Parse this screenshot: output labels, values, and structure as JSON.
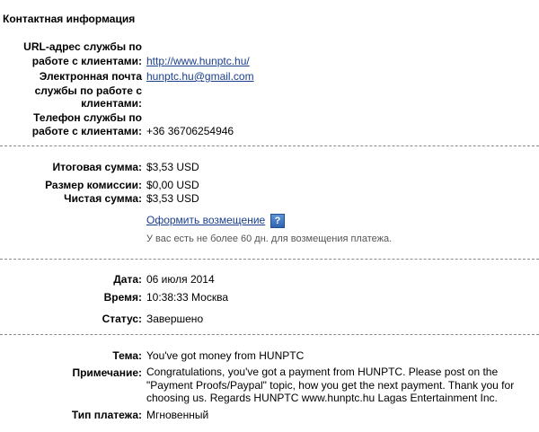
{
  "contact": {
    "title": "Контактная информация",
    "url_label_line1": "URL-адрес службы по",
    "url_label_line2": "работе с клиентами:",
    "url_value": "http://www.hunptc.hu/",
    "email_label_line1": "Электронная почта",
    "email_label_line2": "службы по работе с",
    "email_label_line3": "клиентами:",
    "email_value": "hunptc.hu@gmail.com",
    "phone_label_line1": "Телефон службы по",
    "phone_label_line2": "работе с клиентами:",
    "phone_value": "+36 36706254946"
  },
  "amounts": {
    "total_label": "Итоговая сумма:",
    "total_value": "$3,53 USD",
    "fee_label": "Размер комиссии:",
    "fee_value": "$0,00 USD",
    "net_label": "Чистая сумма:",
    "net_value": "$3,53 USD",
    "refund_link": "Оформить возмещение",
    "help_icon_text": "?",
    "refund_note": "У вас есть не более 60 дн. для возмещения платежа."
  },
  "details": {
    "date_label": "Дата:",
    "date_value": "06 июля 2014",
    "time_label": "Время:",
    "time_value": "10:38:33 Москва",
    "status_label": "Статус:",
    "status_value": "Завершено"
  },
  "message": {
    "subject_label": "Тема:",
    "subject_value": "You've got money from HUNPTC",
    "memo_label": "Примечание:",
    "memo_value": "Congratulations, you've got a payment from HUNPTC. Please post on the \"Payment Proofs/Paypal\" topic, how you get the next payment. Thank you for choosing us. Regards HUNPTC www.hunptc.hu Lagas Entertainment Inc.",
    "type_label": "Тип платежа:",
    "type_value": "Мгновенный"
  },
  "icons": {
    "help": "help-icon"
  }
}
